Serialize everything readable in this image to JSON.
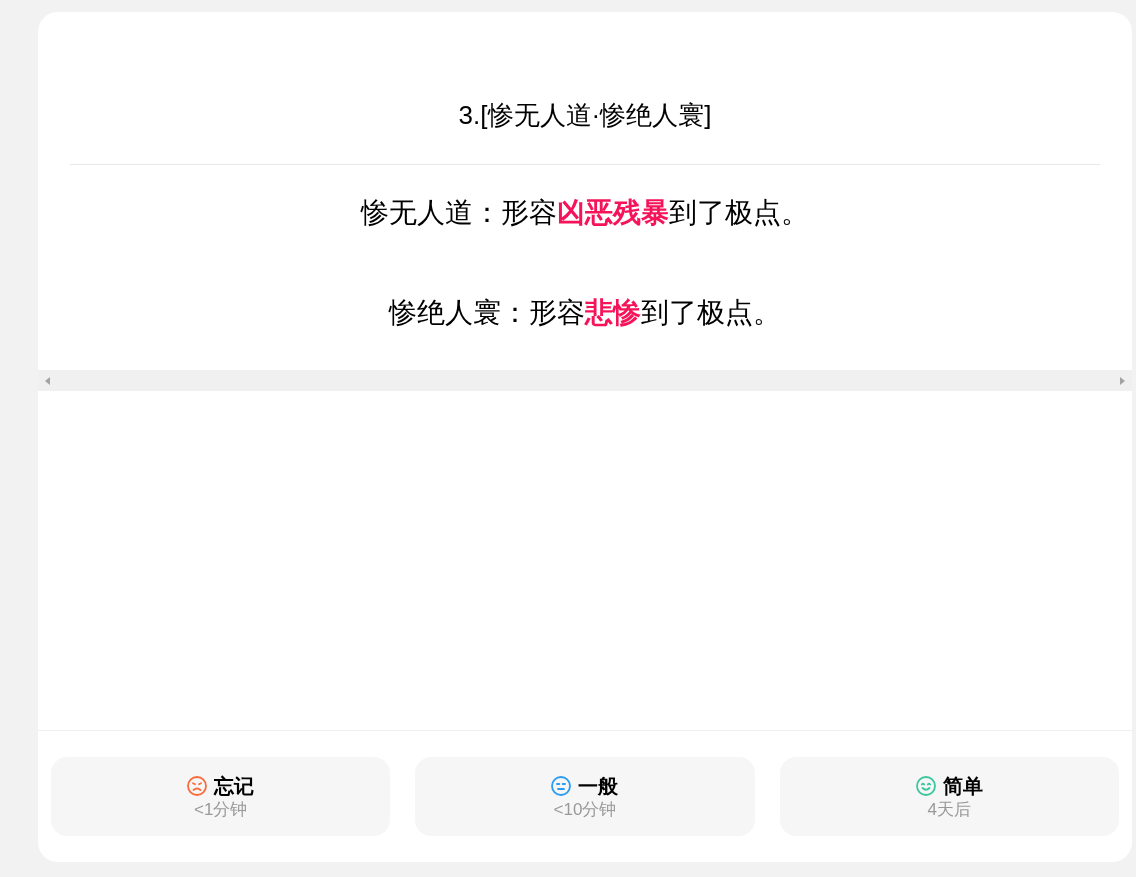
{
  "card": {
    "title": "3.[惨无人道·惨绝人寰]",
    "definitions": [
      "惨无人道：形容**凶恶残暴**到了极点。",
      "惨绝人寰：形容**悲惨**到了极点。"
    ]
  },
  "rating_buttons": [
    {
      "label": "忘记",
      "interval": "<1分钟",
      "color": "#fa6a3c"
    },
    {
      "label": "一般",
      "interval": "<10分钟",
      "color": "#2b9cf2"
    },
    {
      "label": "简单",
      "interval": "4天后",
      "color": "#3cc69e"
    }
  ]
}
